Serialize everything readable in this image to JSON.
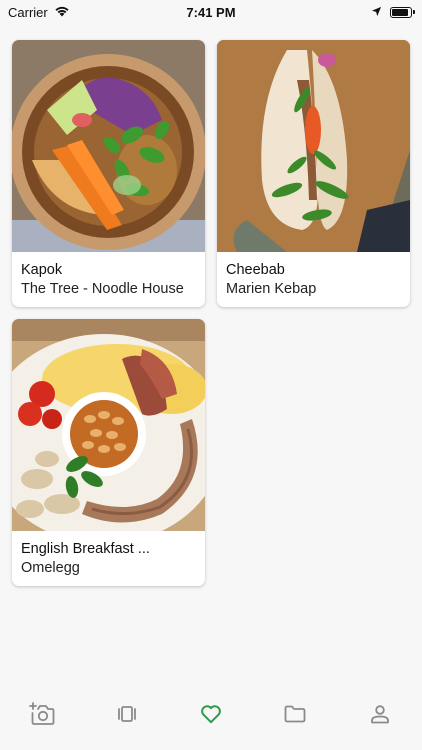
{
  "status_bar": {
    "carrier": "Carrier",
    "time": "7:41 PM",
    "icons": [
      "wifi-icon",
      "location-arrow-icon",
      "battery-icon"
    ]
  },
  "cards": [
    {
      "title": "Kapok",
      "subtitle": "The Tree - Noodle House",
      "image": "noodle-bowl-photo"
    },
    {
      "title": "Cheebab",
      "subtitle": "Marien Kebap",
      "image": "kebab-sandwich-photo"
    },
    {
      "title": "English Breakfast ...",
      "subtitle": "Omelegg",
      "image": "english-breakfast-photo"
    }
  ],
  "tab_bar": {
    "active": "favorites",
    "accent_color": "#2e9b4b",
    "inactive_color": "#8a8a8a",
    "tabs": [
      {
        "name": "add-photo",
        "icon": "camera-add-icon"
      },
      {
        "name": "feed",
        "icon": "carousel-icon"
      },
      {
        "name": "favorites",
        "icon": "heart-icon"
      },
      {
        "name": "collections",
        "icon": "folder-icon"
      },
      {
        "name": "profile",
        "icon": "person-icon"
      }
    ]
  }
}
